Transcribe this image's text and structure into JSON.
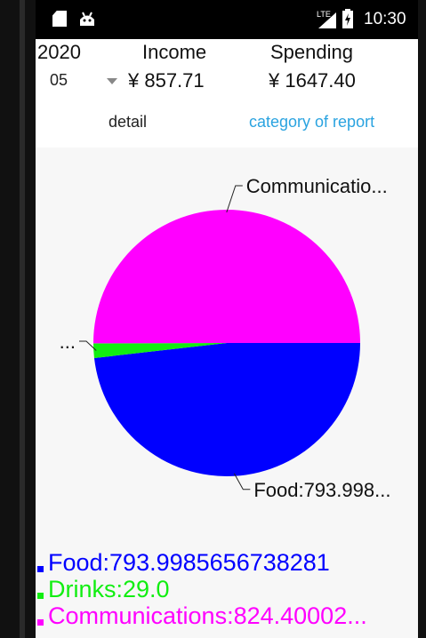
{
  "status_bar": {
    "network_label": "LTE",
    "time": "10:30",
    "icons": [
      "sd-card-icon",
      "android-debug-icon",
      "signal-icon",
      "battery-charging-icon"
    ]
  },
  "summary": {
    "year": "2020",
    "month": "05",
    "income_label": "Income",
    "income_value": "¥ 857.71",
    "spending_label": "Spending",
    "spending_value": "¥ 1647.40"
  },
  "tabs": [
    {
      "label": "detail",
      "active": false
    },
    {
      "label": "category of report",
      "active": true
    }
  ],
  "colors": {
    "food": "#0000ff",
    "drinks": "#11ee11",
    "communications": "#ff00ff",
    "active_tab": "#2aa3e0",
    "background": "#f7f7f7"
  },
  "chart_data": {
    "type": "pie",
    "categories": [
      "Food",
      "Drinks",
      "Communications"
    ],
    "values": [
      793.9985656738281,
      29.0,
      824.40002
    ],
    "colors": [
      "#0000ff",
      "#11ee11",
      "#ff00ff"
    ],
    "slice_labels": [
      "Food:793.998...",
      "...",
      "Communicatio..."
    ],
    "legend": [
      "Food:793.9985656738281",
      "Drinks:29.0",
      "Communications:824.40002..."
    ]
  }
}
